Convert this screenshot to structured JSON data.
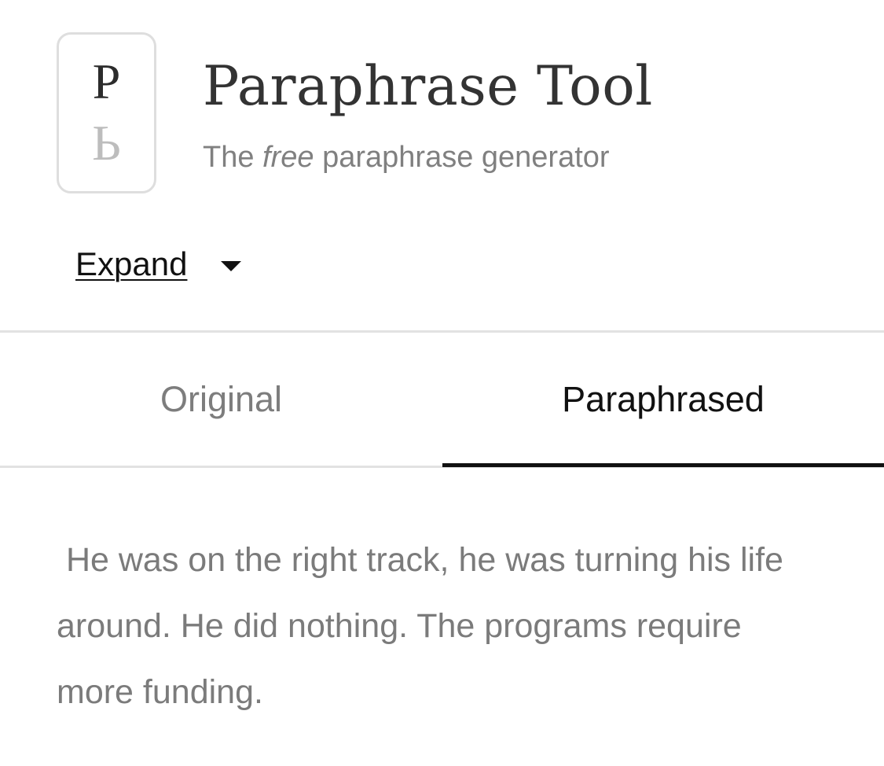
{
  "logo": {
    "top_letter": "P",
    "bottom_letter": "Ь"
  },
  "header": {
    "title": "Paraphrase Tool",
    "subtitle_before": "The ",
    "subtitle_emphasis": "free",
    "subtitle_after": " paraphrase generator"
  },
  "mode": {
    "label": "Expand",
    "icon": "caret-down-icon"
  },
  "tabs": [
    {
      "label": "Original",
      "active": false
    },
    {
      "label": "Paraphrased",
      "active": true
    }
  ],
  "output": {
    "text": " He was on the right track, he was turning his life around. He did nothing. The programs require more funding."
  },
  "colors": {
    "title": "#333333",
    "subtitle": "#808080",
    "inactive_tab": "#7d7d7d",
    "active_tab": "#111111",
    "body_text": "#7b7b7b",
    "divider": "#e2e2e2"
  }
}
